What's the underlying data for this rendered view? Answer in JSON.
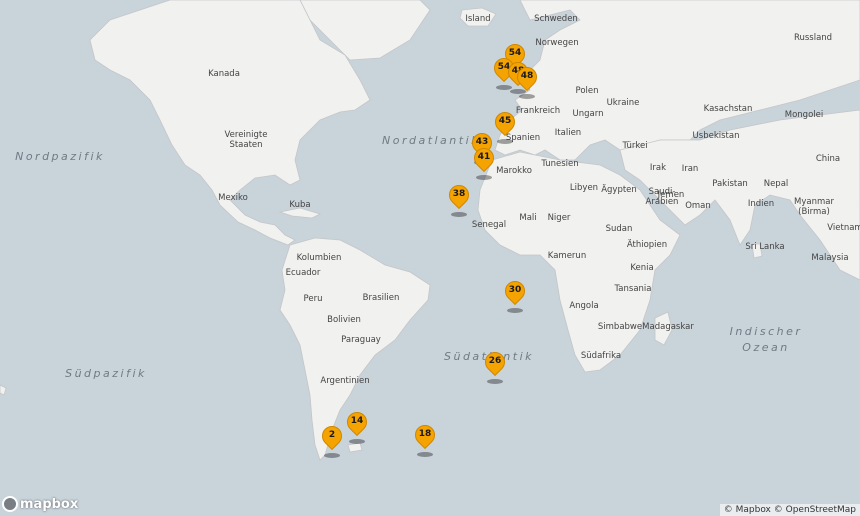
{
  "countries": [
    "Island",
    "Schweden",
    "Norwegen",
    "Russland",
    "Kanada",
    "Vereinigte Staaten",
    "Mexiko",
    "Kuba",
    "Kolumbien",
    "Ecuador",
    "Peru",
    "Brasilien",
    "Bolivien",
    "Paraguay",
    "Argentinien",
    "Polen",
    "Ukraine",
    "Kasachstan",
    "Mongolei",
    "Frankreich",
    "Ungarn",
    "Italien",
    "Usbekistan",
    "Türkei",
    "Spanien",
    "China",
    "Tunesien",
    "Irak",
    "Iran",
    "Marokko",
    "Libyen",
    "Ägypten",
    "Saudi-Arabien",
    "Pakistan",
    "Nepal",
    "Indien",
    "Oman",
    "Jemen",
    "Myanmar (Birma)",
    "Mali",
    "Niger",
    "Senegal",
    "Sudan",
    "Äthiopien",
    "Sri Lanka",
    "Malaysia",
    "Vietnam",
    "Kamerun",
    "Kenia",
    "Tansania",
    "Angola",
    "Simbabwe",
    "Madagaskar",
    "Südafrika"
  ],
  "oceans": [
    "Nordpazifik",
    "Nordatlantik",
    "Südpazifik",
    "Südatlantik",
    "Indischer Ozean"
  ],
  "markers": [
    "54",
    "54",
    "48",
    "48",
    "45",
    "43",
    "41",
    "38",
    "30",
    "26",
    "14",
    "2",
    "18"
  ],
  "branding": {
    "logo": "mapbox"
  },
  "attribution": "© Mapbox © OpenStreetMap"
}
